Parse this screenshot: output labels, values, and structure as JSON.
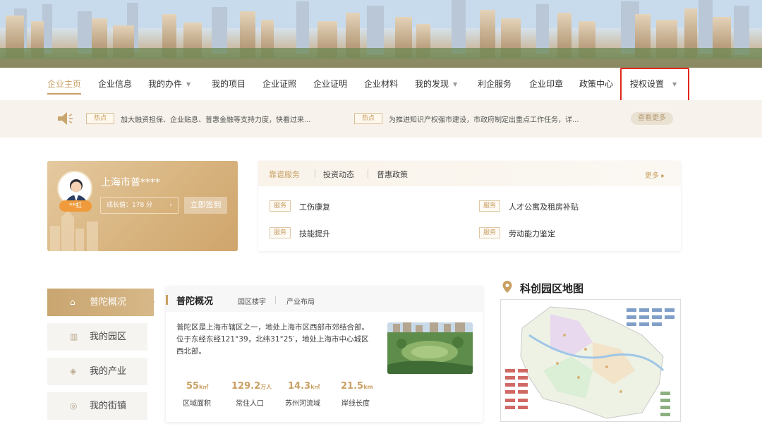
{
  "nav": {
    "items": [
      {
        "label": "企业主页",
        "active": true
      },
      {
        "label": "企业信息"
      },
      {
        "label": "我的办件",
        "dropdown": true
      },
      {
        "label": "我的项目"
      },
      {
        "label": "企业证照"
      },
      {
        "label": "企业证明"
      },
      {
        "label": "企业材料"
      },
      {
        "label": "我的发现",
        "dropdown": true
      },
      {
        "label": "利企服务"
      },
      {
        "label": "企业印章"
      },
      {
        "label": "政策中心"
      },
      {
        "label": "授权设置",
        "dropdown": true,
        "highlighted": true
      }
    ],
    "caret_icon": "chevron-down-icon"
  },
  "notice": {
    "speaker_icon": "speaker-icon",
    "items": [
      {
        "tag": "热点",
        "text": "加大融资担保、企业贴息、普惠金融等支持力度，快看过来..."
      },
      {
        "tag": "热点",
        "text": "为推进知识产权强市建设，市政府制定出重点工作任务，详..."
      }
    ],
    "more_label": "查看更多"
  },
  "user": {
    "name": "上海市普****",
    "badge": "**虹",
    "growth_label": "成长值：178 分",
    "growth_arrow": "›",
    "signin_label": "立即签到"
  },
  "services": {
    "tabs": [
      "靠谱服务",
      "投资动态",
      "普惠政策"
    ],
    "more_label": "更多",
    "more_arrow": "▸",
    "items": [
      {
        "tag": "服务",
        "text": "工伤康复"
      },
      {
        "tag": "服务",
        "text": "人才公寓及租房补贴"
      },
      {
        "tag": "服务",
        "text": "技能提升"
      },
      {
        "tag": "服务",
        "text": "劳动能力鉴定"
      }
    ]
  },
  "left_menu": {
    "items": [
      {
        "label": "普陀概况",
        "icon": "home-icon",
        "glyph": "⌂",
        "active": true
      },
      {
        "label": "我的园区",
        "icon": "building-icon",
        "glyph": "▥"
      },
      {
        "label": "我的产业",
        "icon": "layers-icon",
        "glyph": "◈"
      },
      {
        "label": "我的街镇",
        "icon": "location-icon",
        "glyph": "◎"
      }
    ]
  },
  "overview": {
    "title": "普陀概况",
    "tabs": [
      "园区楼宇",
      "产业布局"
    ],
    "description": "普陀区是上海市辖区之一，地处上海市区西部市郊结合部。位于东经东经121°39，北纬31°25′，地处上海市中心城区西北部。",
    "stats": [
      {
        "value": "55",
        "unit": "k㎡",
        "label": "区域面积"
      },
      {
        "value": "129.2",
        "unit": "万人",
        "label": "常住人口"
      },
      {
        "value": "14.3",
        "unit": "k㎡",
        "label": "苏州河流域"
      },
      {
        "value": "21.5",
        "unit": "km",
        "label": "岸线长度"
      }
    ]
  },
  "map": {
    "title": "科创园区地图",
    "pin_icon": "map-pin-icon"
  },
  "colors": {
    "accent": "#c9a063",
    "highlight_border": "#e2261b",
    "badge_orange": "#f09b3b"
  }
}
